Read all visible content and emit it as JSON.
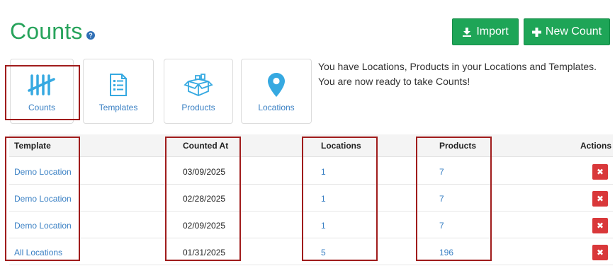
{
  "header": {
    "title": "Counts",
    "help_glyph": "?"
  },
  "toolbar": {
    "import_label": "Import",
    "new_count_label": "New Count"
  },
  "tiles": [
    {
      "label": "Counts",
      "icon": "tally-icon"
    },
    {
      "label": "Templates",
      "icon": "checklist-icon"
    },
    {
      "label": "Products",
      "icon": "box-icon"
    },
    {
      "label": "Locations",
      "icon": "map-pin-icon"
    }
  ],
  "info": {
    "line1": "You have Locations, Products in your Locations and Templates.",
    "line2": "You are now ready to take Counts!"
  },
  "table": {
    "columns": [
      "Template",
      "Counted At",
      "Locations",
      "Products",
      "Actions"
    ],
    "rows": [
      {
        "template": "Demo Location",
        "counted_at": "03/09/2025",
        "locations": "1",
        "products": "7"
      },
      {
        "template": "Demo Location",
        "counted_at": "02/28/2025",
        "locations": "1",
        "products": "7"
      },
      {
        "template": "Demo Location",
        "counted_at": "02/09/2025",
        "locations": "1",
        "products": "7"
      },
      {
        "template": "All Locations",
        "counted_at": "01/31/2025",
        "locations": "5",
        "products": "196"
      }
    ],
    "delete_glyph": "✖"
  },
  "colors": {
    "brand_green": "#1ea557",
    "title_green": "#27a35b",
    "link_blue": "#3a80c4",
    "icon_blue": "#36a9e1",
    "danger_red": "#d9383a",
    "highlight_red": "#a01c1c"
  }
}
